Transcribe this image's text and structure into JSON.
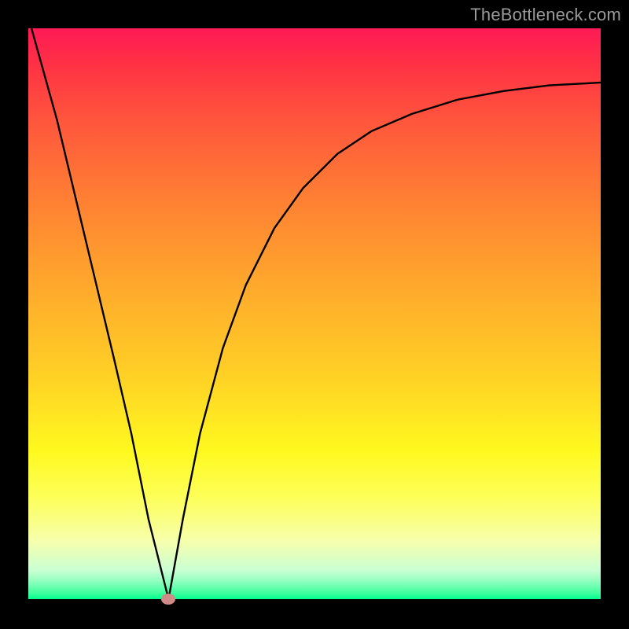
{
  "watermark": "TheBottleneck.com",
  "chart_data": {
    "type": "line",
    "title": "",
    "xlabel": "",
    "ylabel": "",
    "xlim": [
      0,
      100
    ],
    "ylim": [
      0,
      100
    ],
    "grid": false,
    "series": [
      {
        "name": "curve",
        "x": [
          0,
          5,
          10,
          15,
          18,
          21,
          24.5,
          27,
          30,
          34,
          38,
          43,
          48,
          54,
          60,
          67,
          75,
          83,
          91,
          100
        ],
        "values": [
          102,
          84,
          63,
          42,
          29,
          14,
          0,
          14,
          29,
          44,
          55,
          65,
          72,
          78,
          82,
          85,
          87.5,
          89,
          90,
          90.5
        ]
      }
    ],
    "marker": {
      "x": 24.5,
      "y": 0
    },
    "colors": {
      "curve": "#000000",
      "marker": "#cf8b88",
      "frame": "#000000"
    }
  }
}
